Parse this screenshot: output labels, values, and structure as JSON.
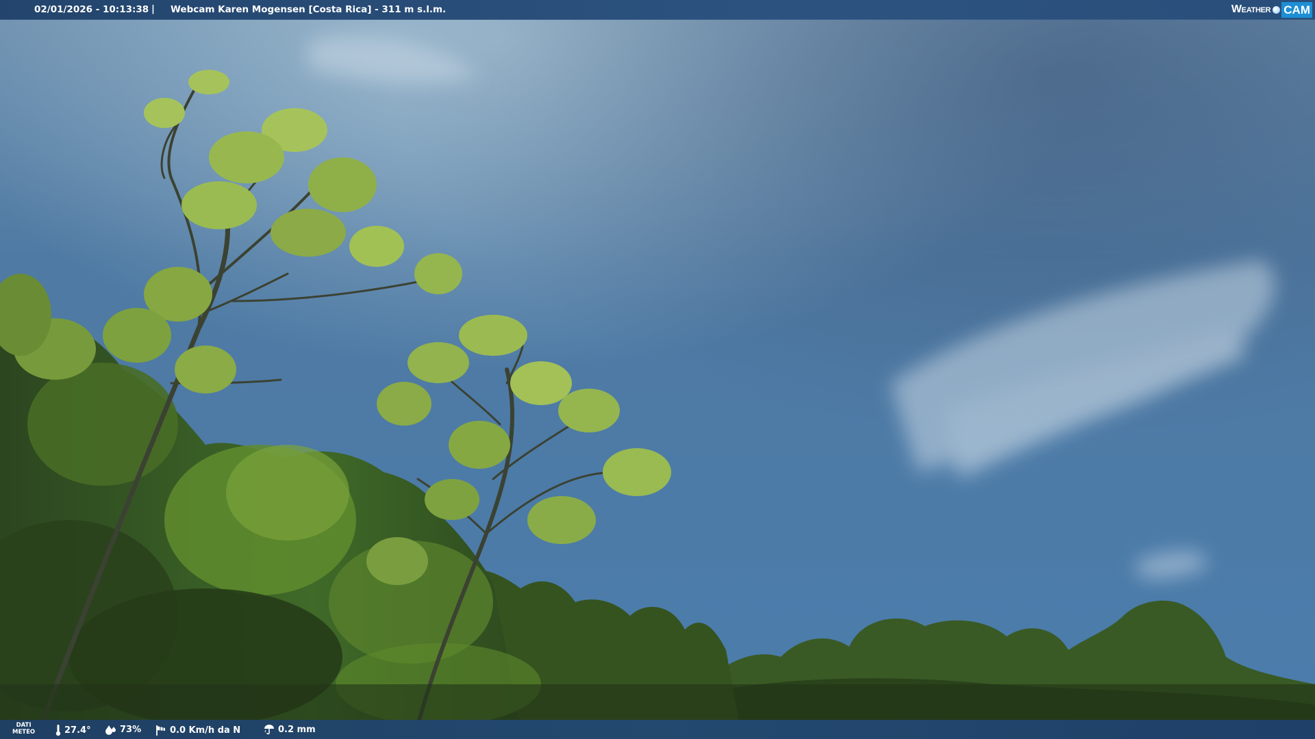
{
  "header": {
    "datetime": "02/01/2026 - 10:13:38",
    "separator": "|",
    "camera_name": "Webcam Karen Mogensen [Costa Rica] - 311 m s.l.m."
  },
  "brand": {
    "weather": "Weather",
    "cam": "CAM"
  },
  "footer": {
    "dati_line1": "DATI",
    "dati_line2": "METEO",
    "temperature": "27.4°",
    "humidity": "73%",
    "wind": "0.0 Km/h da N",
    "rain": "0.2 mm"
  },
  "icons": {
    "temperature": "thermometer-icon",
    "humidity": "humidity-drop-icon",
    "wind": "windsock-icon",
    "rain": "rain-icon"
  },
  "colors": {
    "sky_top": "#5b84a6",
    "sky_bottom": "#4a7aa8",
    "bar": "#23456d",
    "brand_cam": "#1d8fd4"
  }
}
